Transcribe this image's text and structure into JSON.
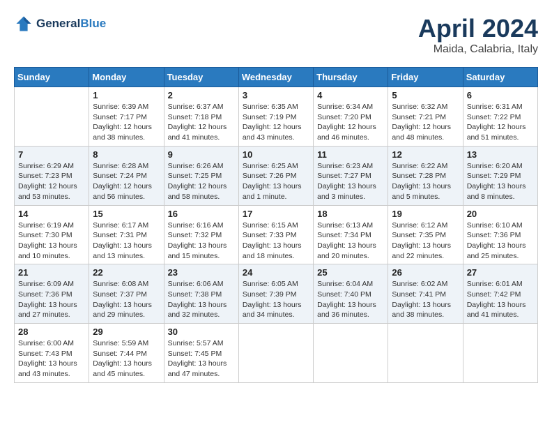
{
  "header": {
    "logo_line1": "General",
    "logo_line2": "Blue",
    "month_title": "April 2024",
    "location": "Maida, Calabria, Italy"
  },
  "weekdays": [
    "Sunday",
    "Monday",
    "Tuesday",
    "Wednesday",
    "Thursday",
    "Friday",
    "Saturday"
  ],
  "weeks": [
    [
      {
        "day": "",
        "sunrise": "",
        "sunset": "",
        "daylight": ""
      },
      {
        "day": "1",
        "sunrise": "Sunrise: 6:39 AM",
        "sunset": "Sunset: 7:17 PM",
        "daylight": "Daylight: 12 hours and 38 minutes."
      },
      {
        "day": "2",
        "sunrise": "Sunrise: 6:37 AM",
        "sunset": "Sunset: 7:18 PM",
        "daylight": "Daylight: 12 hours and 41 minutes."
      },
      {
        "day": "3",
        "sunrise": "Sunrise: 6:35 AM",
        "sunset": "Sunset: 7:19 PM",
        "daylight": "Daylight: 12 hours and 43 minutes."
      },
      {
        "day": "4",
        "sunrise": "Sunrise: 6:34 AM",
        "sunset": "Sunset: 7:20 PM",
        "daylight": "Daylight: 12 hours and 46 minutes."
      },
      {
        "day": "5",
        "sunrise": "Sunrise: 6:32 AM",
        "sunset": "Sunset: 7:21 PM",
        "daylight": "Daylight: 12 hours and 48 minutes."
      },
      {
        "day": "6",
        "sunrise": "Sunrise: 6:31 AM",
        "sunset": "Sunset: 7:22 PM",
        "daylight": "Daylight: 12 hours and 51 minutes."
      }
    ],
    [
      {
        "day": "7",
        "sunrise": "Sunrise: 6:29 AM",
        "sunset": "Sunset: 7:23 PM",
        "daylight": "Daylight: 12 hours and 53 minutes."
      },
      {
        "day": "8",
        "sunrise": "Sunrise: 6:28 AM",
        "sunset": "Sunset: 7:24 PM",
        "daylight": "Daylight: 12 hours and 56 minutes."
      },
      {
        "day": "9",
        "sunrise": "Sunrise: 6:26 AM",
        "sunset": "Sunset: 7:25 PM",
        "daylight": "Daylight: 12 hours and 58 minutes."
      },
      {
        "day": "10",
        "sunrise": "Sunrise: 6:25 AM",
        "sunset": "Sunset: 7:26 PM",
        "daylight": "Daylight: 13 hours and 1 minute."
      },
      {
        "day": "11",
        "sunrise": "Sunrise: 6:23 AM",
        "sunset": "Sunset: 7:27 PM",
        "daylight": "Daylight: 13 hours and 3 minutes."
      },
      {
        "day": "12",
        "sunrise": "Sunrise: 6:22 AM",
        "sunset": "Sunset: 7:28 PM",
        "daylight": "Daylight: 13 hours and 5 minutes."
      },
      {
        "day": "13",
        "sunrise": "Sunrise: 6:20 AM",
        "sunset": "Sunset: 7:29 PM",
        "daylight": "Daylight: 13 hours and 8 minutes."
      }
    ],
    [
      {
        "day": "14",
        "sunrise": "Sunrise: 6:19 AM",
        "sunset": "Sunset: 7:30 PM",
        "daylight": "Daylight: 13 hours and 10 minutes."
      },
      {
        "day": "15",
        "sunrise": "Sunrise: 6:17 AM",
        "sunset": "Sunset: 7:31 PM",
        "daylight": "Daylight: 13 hours and 13 minutes."
      },
      {
        "day": "16",
        "sunrise": "Sunrise: 6:16 AM",
        "sunset": "Sunset: 7:32 PM",
        "daylight": "Daylight: 13 hours and 15 minutes."
      },
      {
        "day": "17",
        "sunrise": "Sunrise: 6:15 AM",
        "sunset": "Sunset: 7:33 PM",
        "daylight": "Daylight: 13 hours and 18 minutes."
      },
      {
        "day": "18",
        "sunrise": "Sunrise: 6:13 AM",
        "sunset": "Sunset: 7:34 PM",
        "daylight": "Daylight: 13 hours and 20 minutes."
      },
      {
        "day": "19",
        "sunrise": "Sunrise: 6:12 AM",
        "sunset": "Sunset: 7:35 PM",
        "daylight": "Daylight: 13 hours and 22 minutes."
      },
      {
        "day": "20",
        "sunrise": "Sunrise: 6:10 AM",
        "sunset": "Sunset: 7:36 PM",
        "daylight": "Daylight: 13 hours and 25 minutes."
      }
    ],
    [
      {
        "day": "21",
        "sunrise": "Sunrise: 6:09 AM",
        "sunset": "Sunset: 7:36 PM",
        "daylight": "Daylight: 13 hours and 27 minutes."
      },
      {
        "day": "22",
        "sunrise": "Sunrise: 6:08 AM",
        "sunset": "Sunset: 7:37 PM",
        "daylight": "Daylight: 13 hours and 29 minutes."
      },
      {
        "day": "23",
        "sunrise": "Sunrise: 6:06 AM",
        "sunset": "Sunset: 7:38 PM",
        "daylight": "Daylight: 13 hours and 32 minutes."
      },
      {
        "day": "24",
        "sunrise": "Sunrise: 6:05 AM",
        "sunset": "Sunset: 7:39 PM",
        "daylight": "Daylight: 13 hours and 34 minutes."
      },
      {
        "day": "25",
        "sunrise": "Sunrise: 6:04 AM",
        "sunset": "Sunset: 7:40 PM",
        "daylight": "Daylight: 13 hours and 36 minutes."
      },
      {
        "day": "26",
        "sunrise": "Sunrise: 6:02 AM",
        "sunset": "Sunset: 7:41 PM",
        "daylight": "Daylight: 13 hours and 38 minutes."
      },
      {
        "day": "27",
        "sunrise": "Sunrise: 6:01 AM",
        "sunset": "Sunset: 7:42 PM",
        "daylight": "Daylight: 13 hours and 41 minutes."
      }
    ],
    [
      {
        "day": "28",
        "sunrise": "Sunrise: 6:00 AM",
        "sunset": "Sunset: 7:43 PM",
        "daylight": "Daylight: 13 hours and 43 minutes."
      },
      {
        "day": "29",
        "sunrise": "Sunrise: 5:59 AM",
        "sunset": "Sunset: 7:44 PM",
        "daylight": "Daylight: 13 hours and 45 minutes."
      },
      {
        "day": "30",
        "sunrise": "Sunrise: 5:57 AM",
        "sunset": "Sunset: 7:45 PM",
        "daylight": "Daylight: 13 hours and 47 minutes."
      },
      {
        "day": "",
        "sunrise": "",
        "sunset": "",
        "daylight": ""
      },
      {
        "day": "",
        "sunrise": "",
        "sunset": "",
        "daylight": ""
      },
      {
        "day": "",
        "sunrise": "",
        "sunset": "",
        "daylight": ""
      },
      {
        "day": "",
        "sunrise": "",
        "sunset": "",
        "daylight": ""
      }
    ]
  ]
}
